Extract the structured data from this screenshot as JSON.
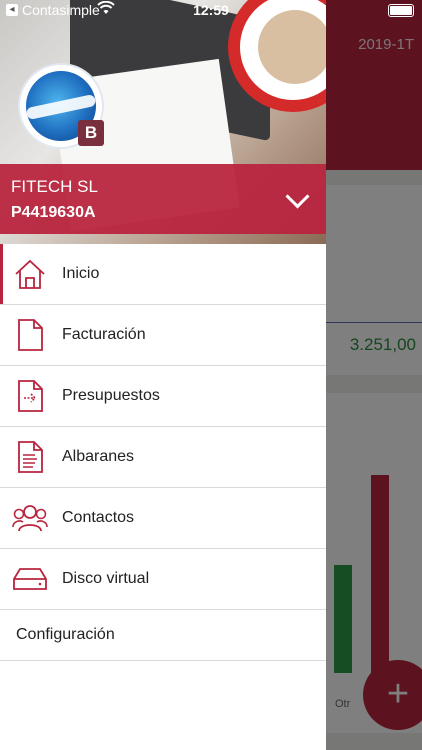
{
  "status_bar": {
    "carrier": "Contasimple",
    "time": "12:59",
    "back_icon": "back-arrow-icon",
    "wifi_icon": "wifi-icon",
    "battery_icon": "battery-icon"
  },
  "background": {
    "period": "2019-1T",
    "amount": "3.251,00",
    "chart_tick": "Otr",
    "fab_label": "+",
    "accent": "#b8253e",
    "positive": "#2e9a44"
  },
  "drawer": {
    "company": {
      "name": "FITECH SL",
      "id": "P4419630A"
    },
    "badge": "B",
    "menu": [
      {
        "label": "Inicio",
        "icon": "home-icon",
        "active": true
      },
      {
        "label": "Facturación",
        "icon": "document-icon"
      },
      {
        "label": "Presupuestos",
        "icon": "document-arrow-icon"
      },
      {
        "label": "Albaranes",
        "icon": "document-list-icon"
      },
      {
        "label": "Contactos",
        "icon": "contacts-icon"
      },
      {
        "label": "Disco virtual",
        "icon": "drive-icon"
      }
    ],
    "settings_label": "Configuración"
  }
}
